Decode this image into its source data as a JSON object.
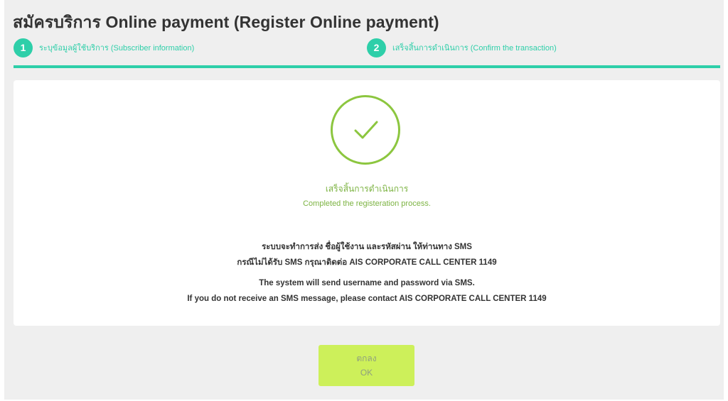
{
  "header": {
    "title": "สมัครบริการ Online payment (Register Online payment)"
  },
  "steps": [
    {
      "number": "1",
      "label": "ระบุข้อมูลผู้ใช้บริการ (Subscriber information)"
    },
    {
      "number": "2",
      "label": "เสร็จสิ้นการดำเนินการ (Confirm the transaction)"
    }
  ],
  "colors": {
    "accent": "#2ecfa9",
    "success": "#8cc63f",
    "button": "#cdf05a"
  },
  "result": {
    "icon": "check-circle-icon",
    "title_th": "เสร็จสิ้นการดำเนินการ",
    "title_en": "Completed the registeration process."
  },
  "message": {
    "th_line1": "ระบบจะทำการส่ง ชื่อผู้ใช้งาน และรหัสผ่าน ให้ท่านทาง SMS",
    "th_line2": "กรณีไม่ได้รับ SMS กรุณาติดต่อ AIS CORPORATE CALL CENTER 1149",
    "en_line1": "The system will send username and password via SMS.",
    "en_line2": "If you do not receive an SMS message, please contact AIS CORPORATE CALL CENTER 1149"
  },
  "ok_button": {
    "label_th": "ตกลง",
    "label_en": "OK"
  }
}
